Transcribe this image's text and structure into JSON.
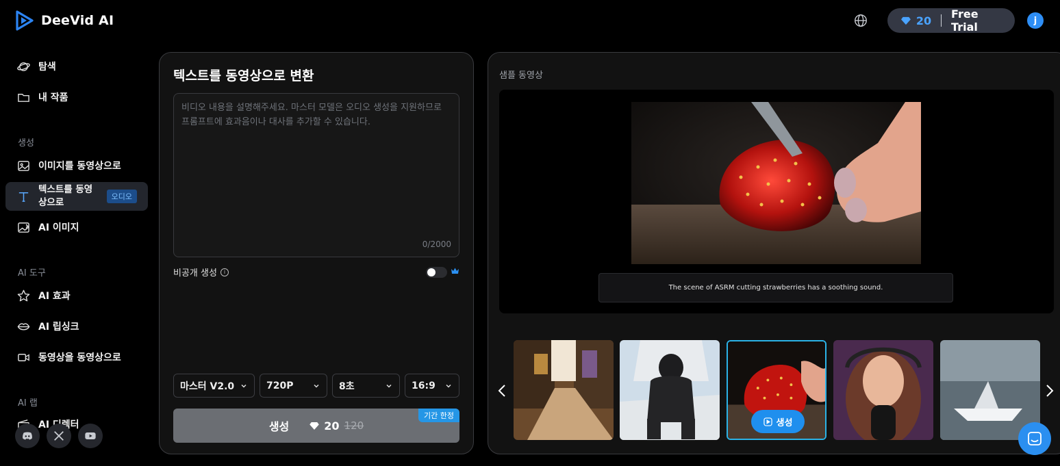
{
  "app": {
    "name": "DeeVid AI"
  },
  "header": {
    "credits": "20",
    "plan": "Free Trial",
    "avatar_initial": "j"
  },
  "sidebar": {
    "items": [
      {
        "label": "탐색",
        "icon": "planet-icon"
      },
      {
        "label": "내 작품",
        "icon": "folder-icon"
      }
    ],
    "sections": [
      {
        "title": "생성",
        "items": [
          {
            "label": "이미지를 동영상으로",
            "icon": "image-icon"
          },
          {
            "label": "텍스트를 동영상으로",
            "icon": "text-icon",
            "badge": "오디오",
            "active": true
          },
          {
            "label": "AI 이미지",
            "icon": "image-sparkle-icon"
          }
        ]
      },
      {
        "title": "AI 도구",
        "items": [
          {
            "label": "AI 효과",
            "icon": "star-icon"
          },
          {
            "label": "AI 립싱크",
            "icon": "lips-icon"
          },
          {
            "label": "동영상을 동영상으로",
            "icon": "video-icon"
          }
        ]
      },
      {
        "title": "AI 랩",
        "items": [
          {
            "label": "AI 디렉터",
            "icon": "clapper-icon"
          }
        ]
      }
    ],
    "social": [
      "discord-icon",
      "x-icon",
      "youtube-icon"
    ]
  },
  "form": {
    "title": "텍스트를 동영상으로 변환",
    "prompt_placeholder": "비디오 내용을 설명해주세요. 마스터 모델은 오디오 생성을 지원하므로 프롬프트에 효과음이나 대사를 추가할 수 있습니다.",
    "prompt_value": "",
    "counter": "0/2000",
    "private_label": "비공개 생성",
    "private_on": false,
    "model": "마스터 V2.0",
    "resolution": "720P",
    "duration": "8초",
    "aspect": "16:9",
    "generate_label": "생성",
    "cost": "20",
    "old_cost": "120",
    "promo_badge": "기간 한정"
  },
  "sample": {
    "title": "샘플 동영상",
    "caption": "The scene of ASRM cutting strawberries has a soothing sound.",
    "thumb_generate_label": "생성",
    "selected_index": 2
  },
  "colors": {
    "accent": "#2b8ff0",
    "credit_blue": "#4aa3ff",
    "panel": "#121212"
  }
}
